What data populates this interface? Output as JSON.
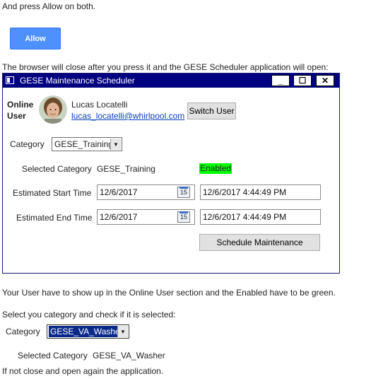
{
  "doc": {
    "line1": "And press Allow on both.",
    "allow_label": "Allow",
    "line2": "The browser will close after you press it and the GESE Scheduler application will open:",
    "line3": "Your User have to show up in the Online User section and the Enabled have to be green.",
    "line4": "Select you category and check if it is selected:",
    "category_label": "Category",
    "category_value": "GESE_VA_Washer",
    "selected_category_label": "Selected Category",
    "selected_category_value": "GESE_VA_Washer",
    "line5": "If not close and open again the application."
  },
  "window": {
    "title": "GESE Maintenance Scheduler",
    "minimize_glyph": "_",
    "maximize_glyph": "☐",
    "close_glyph": "✕",
    "online_user_label_1": "Online",
    "online_user_label_2": "User",
    "user_name": "Lucas Locatelli",
    "user_email": "lucas_locatelli@whirlpool.com",
    "switch_user_label": "Switch User",
    "category_label": "Category",
    "category_value": "GESE_Training",
    "selected_category_label": "Selected Category",
    "selected_category_value": "GESE_Training",
    "enabled_label": "Enabled",
    "enabled_color": "#00ff00",
    "est_start_label": "Estimated Start Time",
    "est_start_date": "12/6/2017",
    "est_start_datetime": "12/6/2017 4:44:49 PM",
    "est_end_label": "Estimated End Time",
    "est_end_date": "12/6/2017",
    "est_end_datetime": "12/6/2017 4:44:49 PM",
    "calendar_glyph": "15",
    "schedule_label": "Schedule Maintenance"
  }
}
